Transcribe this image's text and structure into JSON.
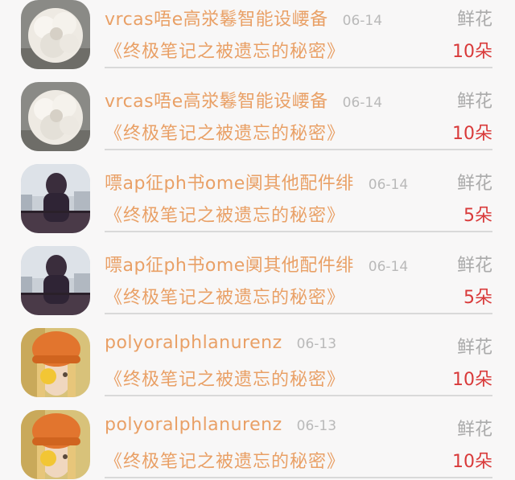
{
  "records": [
    {
      "name": "vrcas唔e高泶鬈智能设崾备",
      "date": "06-14",
      "gift": "鲜花",
      "title": "《终极笔记之被遗忘的秘密》",
      "quantity": "10朵",
      "avatar": "flower-avatar"
    },
    {
      "name": "vrcas唔e高泶鬈智能设崾备",
      "date": "06-14",
      "gift": "鲜花",
      "title": "《终极笔记之被遗忘的秘密》",
      "quantity": "10朵",
      "avatar": "flower-avatar"
    },
    {
      "name": "嘌ap征ph书ome阒其他配件绯",
      "date": "06-14",
      "gift": "鲜花",
      "title": "《终极笔记之被遗忘的秘密》",
      "quantity": "5朵",
      "avatar": "balcony-girl-avatar"
    },
    {
      "name": "嘌ap征ph书ome阒其他配件绯",
      "date": "06-14",
      "gift": "鲜花",
      "title": "《终极笔记之被遗忘的秘密》",
      "quantity": "5朵",
      "avatar": "balcony-girl-avatar"
    },
    {
      "name": "polyoralphlanurenz",
      "date": "06-13",
      "gift": "鲜花",
      "title": "《终极笔记之被遗忘的秘密》",
      "quantity": "10朵",
      "avatar": "orange-hat-girl-avatar"
    },
    {
      "name": "polyoralphlanurenz",
      "date": "06-13",
      "gift": "鲜花",
      "title": "《终极笔记之被遗忘的秘密》",
      "quantity": "10朵",
      "avatar": "orange-hat-girl-avatar"
    }
  ]
}
